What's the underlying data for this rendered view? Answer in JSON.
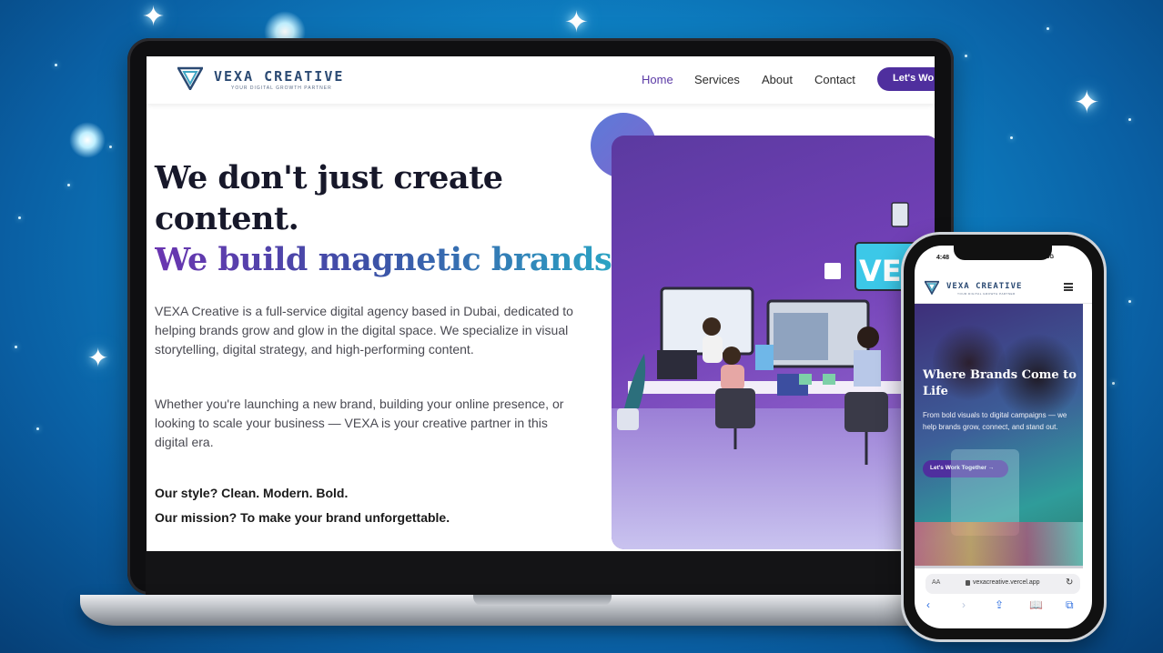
{
  "site": {
    "brand_name": "VEXA CREATIVE",
    "brand_tagline": "YOUR DIGITAL GROWTH PARTNER",
    "nav": [
      {
        "label": "Home",
        "active": true
      },
      {
        "label": "Services",
        "active": false
      },
      {
        "label": "About",
        "active": false
      },
      {
        "label": "Contact",
        "active": false
      }
    ],
    "nav_cta_label": "Let's Wo",
    "hero": {
      "headline_line1": "We don't just create",
      "headline_line2": "content.",
      "headline_line3": "We build magnetic brands.",
      "paragraph1": "VEXA Creative is a full-service digital agency based in Dubai, dedicated to helping brands grow and glow in the digital space. We specialize in visual storytelling, digital strategy, and high-performing content.",
      "paragraph2": "Whether you're launching a new brand, building your online presence, or looking to scale your business — VEXA is your creative partner in this digital era.",
      "style_line": "Our style? Clean. Modern. Bold.",
      "mission_line": "Our mission? To make your brand unforgettable.",
      "image_screen_text": "VEX"
    }
  },
  "phone": {
    "status_time": "4:48",
    "status_right": "5G",
    "brand_name": "VEXA CREATIVE",
    "brand_tagline": "YOUR DIGITAL GROWTH PARTNER",
    "menu_icon": "hamburger-icon",
    "hero_title": "Where Brands Come to Life",
    "hero_text": "From bold visuals to digital campaigns — we help brands grow, connect, and stand out.",
    "cta_label": "Let's Work Together →",
    "url_prefix": "AA",
    "url": "vexacreative.vercel.app",
    "toolbar_icons": [
      "back-icon",
      "forward-icon",
      "share-icon",
      "bookmarks-icon",
      "tabs-icon"
    ]
  },
  "colors": {
    "background": "#0e86c9",
    "accent_purple": "#4f2f9e",
    "heading_dark": "#17182a",
    "gradient_start": "#6a35b0",
    "gradient_end": "#2aa7c5"
  }
}
